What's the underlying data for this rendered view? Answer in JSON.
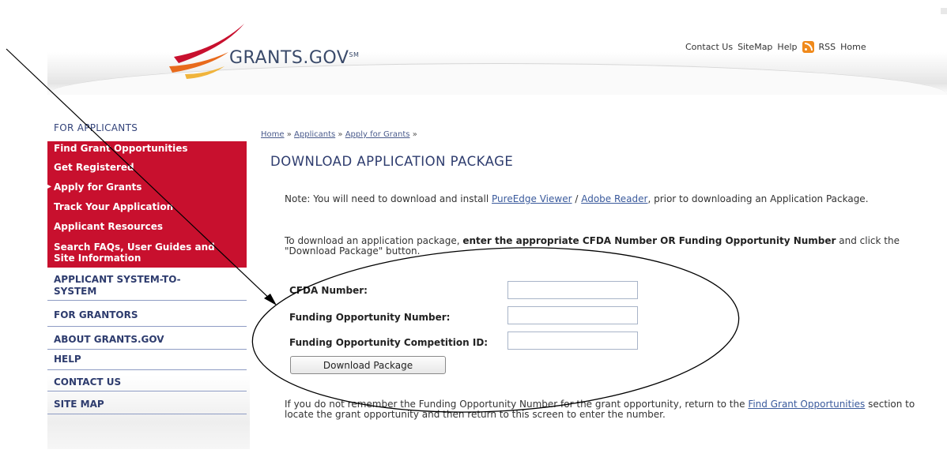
{
  "header": {
    "logo_text": "GRANTS.GOV",
    "logo_mark": "SM",
    "top_links": [
      "Contact Us",
      "SiteMap",
      "Help",
      "RSS",
      "Home"
    ]
  },
  "sidebar": {
    "heading": "FOR APPLICANTS",
    "red_items": [
      {
        "label": "Find Grant Opportunities"
      },
      {
        "label": "Get Registered"
      },
      {
        "label": "Apply for Grants"
      },
      {
        "label": "Track Your Application"
      },
      {
        "label": "Applicant Resources"
      },
      {
        "label": "Search FAQs, User Guides and",
        "label2": "Site Information"
      }
    ],
    "gray_items": [
      {
        "label": "APPLICANT SYSTEM-TO-",
        "label2": "SYSTEM"
      },
      {
        "label": "FOR GRANTORS"
      },
      {
        "label": "ABOUT GRANTS.GOV"
      },
      {
        "label": "HELP"
      },
      {
        "label": "CONTACT US"
      },
      {
        "label": "SITE MAP"
      }
    ]
  },
  "breadcrumb": [
    "Home",
    "Applicants",
    "Apply for Grants"
  ],
  "breadcrumb_sep": "»",
  "main": {
    "title": "DOWNLOAD APPLICATION PACKAGE",
    "note_prefix": "Note: You will need to download and install ",
    "note_link1": "PureEdge Viewer",
    "note_sep": " / ",
    "note_link2": "Adobe Reader",
    "note_suffix": ", prior to downloading an Application Package.",
    "instr_prefix": "To download an application package, ",
    "instr_bold": "enter the appropriate CFDA Number OR Funding Opportunity Number",
    "instr_suffix": " and click the \"Download Package\" button.",
    "form": {
      "cfda_label": "CFDA Number:",
      "cfda_value": "",
      "fon_label": "Funding Opportunity Number:",
      "fon_value": "",
      "comp_label": "Funding Opportunity Competition ID:",
      "comp_value": "",
      "button_label": "Download Package"
    },
    "footer_prefix": "If you do not remember the Funding Opportunity Number for the grant opportunity, return to the ",
    "footer_link": "Find Grant Opportunities",
    "footer_suffix": " section to locate the grant opportunity and then return to this screen to enter the number."
  },
  "colors": {
    "red": "#c8102e",
    "navy": "#2e3c6e",
    "link": "#3a5a9c",
    "rss": "#f08a1c"
  }
}
